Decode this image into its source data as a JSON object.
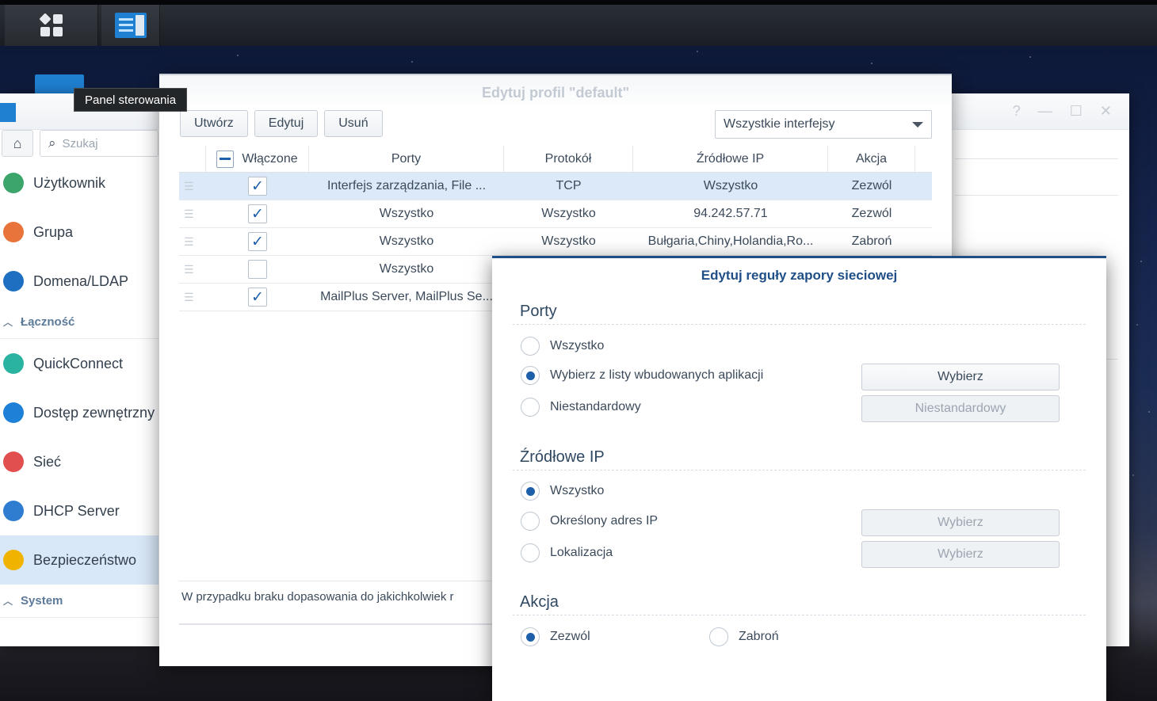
{
  "taskbar": {
    "main_menu_icon": "grid-icon",
    "app_icon": "control-panel-icon"
  },
  "tooltip": "Panel sterowania",
  "control_panel": {
    "search_placeholder": "Szukaj",
    "sidebar": [
      {
        "type": "item",
        "label": "Użytkownik",
        "icon": "user-icon",
        "color": "#3ba56b"
      },
      {
        "type": "item",
        "label": "Grupa",
        "icon": "group-icon",
        "color": "#e8743b"
      },
      {
        "type": "item",
        "label": "Domena/LDAP",
        "icon": "domain-icon",
        "color": "#1e6fc1"
      },
      {
        "type": "group",
        "label": "Łączność"
      },
      {
        "type": "item",
        "label": "QuickConnect",
        "icon": "cloud-icon",
        "color": "#2bb3a1"
      },
      {
        "type": "item",
        "label": "Dostęp zewnętrzny",
        "icon": "globe-icon",
        "color": "#1e80d6"
      },
      {
        "type": "item",
        "label": "Sieć",
        "icon": "home-network-icon",
        "color": "#e24f4f"
      },
      {
        "type": "item",
        "label": "DHCP Server",
        "icon": "dhcp-icon",
        "color": "#2f7dd1"
      },
      {
        "type": "item",
        "label": "Bezpieczeństwo",
        "icon": "shield-icon",
        "color": "#f0b400",
        "active": true
      },
      {
        "type": "group",
        "label": "System"
      }
    ]
  },
  "profile_window": {
    "title": "Edytuj profil \"default\"",
    "toolbar": {
      "create": "Utwórz",
      "edit": "Edytuj",
      "delete": "Usuń"
    },
    "interface_select": "Wszystkie interfejsy",
    "columns": [
      "Włączone",
      "Porty",
      "Protokół",
      "Źródłowe IP",
      "Akcja"
    ],
    "rows": [
      {
        "enabled": true,
        "ports": "Interfejs zarządzania, File ...",
        "protocol": "TCP",
        "source_ip": "Wszystko",
        "action": "Zezwól",
        "selected": true
      },
      {
        "enabled": true,
        "ports": "Wszystko",
        "protocol": "Wszystko",
        "source_ip": "94.242.57.71",
        "action": "Zezwól"
      },
      {
        "enabled": true,
        "ports": "Wszystko",
        "protocol": "Wszystko",
        "source_ip": "Bułgaria,Chiny,Holandia,Ro...",
        "action": "Zabroń"
      },
      {
        "enabled": false,
        "ports": "Wszystko",
        "protocol": "",
        "source_ip": "",
        "action": ""
      },
      {
        "enabled": true,
        "ports": "MailPlus Server, MailPlus Se...",
        "protocol": "",
        "source_ip": "",
        "action": ""
      }
    ],
    "note": "W przypadku braku dopasowania do jakichkolwiek r"
  },
  "rule_dialog": {
    "title": "Edytuj reguły zapory sieciowej",
    "ports": {
      "heading": "Porty",
      "options": [
        "Wszystko",
        "Wybierz z listy wbudowanych aplikacji",
        "Niestandardowy"
      ],
      "selected": 1,
      "select_button": "Wybierz",
      "custom_button": "Niestandardowy"
    },
    "source_ip": {
      "heading": "Źródłowe IP",
      "options": [
        "Wszystko",
        "Określony adres IP",
        "Lokalizacja"
      ],
      "selected": 0,
      "ip_button": "Wybierz",
      "location_button": "Wybierz"
    },
    "action": {
      "heading": "Akcja",
      "options": [
        "Zezwól",
        "Zabroń"
      ],
      "selected": 0
    }
  }
}
